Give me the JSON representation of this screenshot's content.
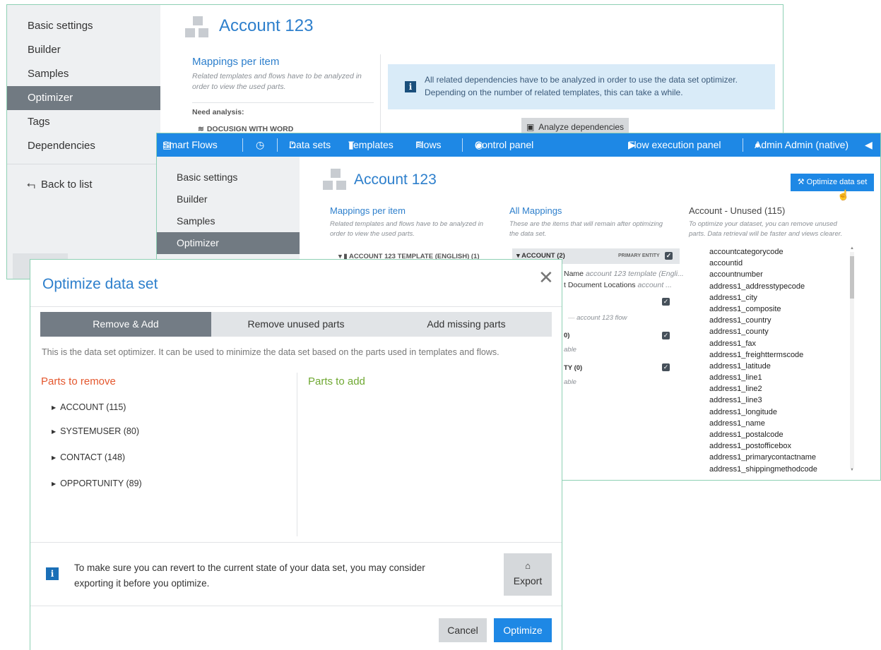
{
  "back_panel": {
    "nav": [
      "Basic settings",
      "Builder",
      "Samples",
      "Optimizer",
      "Tags",
      "Dependencies"
    ],
    "active_nav": "Optimizer",
    "back_to_list": "Back to list",
    "title": "Account 123",
    "mappings_title": "Mappings per item",
    "mappings_note_1": "Related templates and flows have to be analyzed in",
    "mappings_note_2": "order to view the used parts.",
    "need_analysis": "Need analysis:",
    "docusign_item": "DOCUSIGN WITH WORD",
    "info_line_1": "All related dependencies have to be analyzed in order to use the data set optimizer.",
    "info_line_2": "Depending on the number of related templates, this can take a while.",
    "analyze_button": "Analyze dependencies"
  },
  "topbar": {
    "smart_flows": "Smart Flows",
    "data_sets": "Data sets",
    "templates": "Templates",
    "flows": "Flows",
    "control_panel": "Control panel",
    "flow_execution_panel": "Flow execution panel",
    "user": "Admin Admin (native)"
  },
  "middle_panel": {
    "nav": [
      "Basic settings",
      "Builder",
      "Samples",
      "Optimizer"
    ],
    "active_nav": "Optimizer",
    "title": "Account 123",
    "optimize_button": "Optimize data set",
    "mappings_title": "Mappings per item",
    "mappings_note_1": "Related templates and flows have to be analyzed in",
    "mappings_note_2": "order to view the used parts.",
    "template_item": "ACCOUNT 123 TEMPLATE (ENGLISH) (1)",
    "all_mappings_title": "All Mappings",
    "all_mappings_note_1": "These are the items that will remain after optimizing",
    "all_mappings_note_2": "the data set.",
    "account_header": "ACCOUNT (2)",
    "primary_entity": "PRIMARY ENTITY",
    "frag_name": "Name",
    "frag_name_note": "account 123 template (Engli...",
    "frag_doc_loc": "t Document Locations",
    "frag_doc_loc_note": "account ...",
    "frag_flow": "account 123 flow",
    "frag_0": "0)",
    "frag_able": "able",
    "frag_ity": "TY (0)",
    "frag_able2": "able",
    "unused_title": "Account - Unused (115)",
    "unused_note_1": "To optimize your dataset, you can remove unused",
    "unused_note_2": "parts. Data retrieval will be faster and views clearer.",
    "unused_items": [
      "accountcategorycode",
      "accountid",
      "accountnumber",
      "address1_addresstypecode",
      "address1_city",
      "address1_composite",
      "address1_country",
      "address1_county",
      "address1_fax",
      "address1_freighttermscode",
      "address1_latitude",
      "address1_line1",
      "address1_line2",
      "address1_line3",
      "address1_longitude",
      "address1_name",
      "address1_postalcode",
      "address1_postofficebox",
      "address1_primarycontactname",
      "address1_shippingmethodcode"
    ]
  },
  "modal": {
    "title": "Optimize data set",
    "tabs": [
      "Remove & Add",
      "Remove unused parts",
      "Add missing parts"
    ],
    "active_tab": "Remove & Add",
    "description": "This is the data set optimizer. It can be used to minimize the data set based on the parts used in templates and flows.",
    "parts_to_remove": "Parts to remove",
    "parts_to_add": "Parts to add",
    "remove_items": [
      "ACCOUNT (115)",
      "SYSTEMUSER (80)",
      "CONTACT (148)",
      "OPPORTUNITY (89)"
    ],
    "footer_line_1": "To make sure you can revert to the current state of your data set, you may consider",
    "footer_line_2": "exporting it before you optimize.",
    "export_button": "Export",
    "cancel_button": "Cancel",
    "optimize_button": "Optimize"
  },
  "colors": {
    "accent_blue": "#1e88e5",
    "title_blue": "#2d7fcc",
    "remove_red": "#e4572e",
    "add_green": "#6fa832",
    "panel_border": "#8ed0b4",
    "active_nav": "#717a82"
  },
  "icons": [
    "back-arrow-icon",
    "info-icon",
    "document-icon",
    "flow-icon",
    "clock-icon",
    "sitemap-icon",
    "file-icon",
    "gauge-icon",
    "play-icon",
    "user-icon",
    "megaphone-icon",
    "magic-wand-icon",
    "pointer-hand-icon",
    "checkbox-icon",
    "caret-right-icon",
    "caret-down-icon",
    "close-icon",
    "export-icon"
  ]
}
